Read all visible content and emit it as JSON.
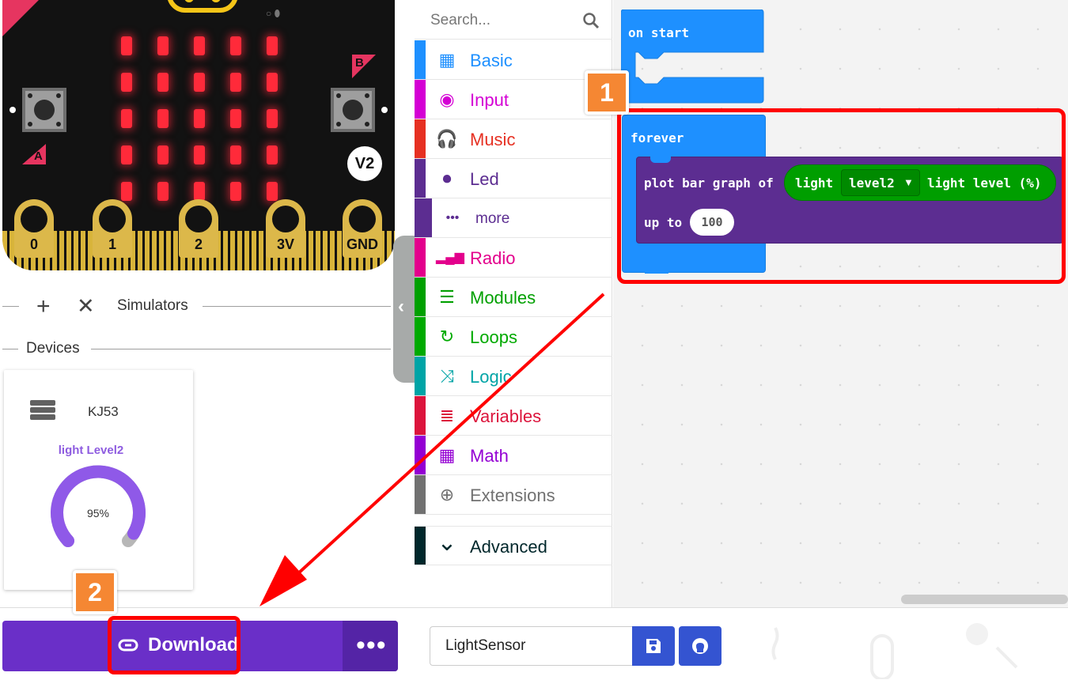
{
  "simulator": {
    "board_version": "V2",
    "button_a_label": "A",
    "button_b_label": "B",
    "pins": [
      "0",
      "1",
      "2",
      "3V",
      "GND"
    ],
    "controls_label": "Simulators",
    "devices_label": "Devices"
  },
  "device_card": {
    "name": "KJ53",
    "sensor_label": "light Level2",
    "gauge_value": "95%",
    "gauge_level": 0.95
  },
  "toolbox": {
    "search_placeholder": "Search...",
    "categories": [
      {
        "label": "Basic",
        "color": "#1e90ff",
        "icon": "grid-icon"
      },
      {
        "label": "Input",
        "color": "#d400d4",
        "icon": "target-icon"
      },
      {
        "label": "Music",
        "color": "#e63022",
        "icon": "headphones-icon"
      },
      {
        "label": "Led",
        "color": "#5c2d91",
        "icon": "toggle-icon"
      },
      {
        "label": "more",
        "color": "#5c2d91",
        "icon": "dots-icon"
      },
      {
        "label": "Radio",
        "color": "#e3008c",
        "icon": "signal-bars-icon"
      },
      {
        "label": "Modules",
        "color": "#00a000",
        "icon": "stack-icon"
      },
      {
        "label": "Loops",
        "color": "#00aa00",
        "icon": "loop-icon"
      },
      {
        "label": "Logic",
        "color": "#00a4a6",
        "icon": "shuffle-icon"
      },
      {
        "label": "Variables",
        "color": "#dc143c",
        "icon": "lines-icon"
      },
      {
        "label": "Math",
        "color": "#9400d3",
        "icon": "calculator-icon"
      },
      {
        "label": "Extensions",
        "color": "#717171",
        "icon": "plus-circle-icon"
      },
      {
        "label": "Advanced",
        "color": "#00272b",
        "icon": "chevron-down-icon"
      }
    ]
  },
  "workspace": {
    "on_start_label": "on start",
    "forever_label": "forever",
    "plot_label": "plot bar graph of",
    "sensor_block_label": "light",
    "sensor_dropdown": "level2",
    "sensor_suffix": "light level (%)",
    "up_to_label": "up to",
    "up_to_value": "100"
  },
  "annotations": {
    "step1": "1",
    "step2": "2",
    "highlight_color": "#ff0000"
  },
  "bottom_bar": {
    "download_label": "Download",
    "project_name": "LightSensor"
  },
  "colors": {
    "download": "#6a2fc8",
    "save": "#3454d1",
    "block_blue": "#1e90ff",
    "block_led": "#5c2d91",
    "block_green": "#009e00"
  }
}
